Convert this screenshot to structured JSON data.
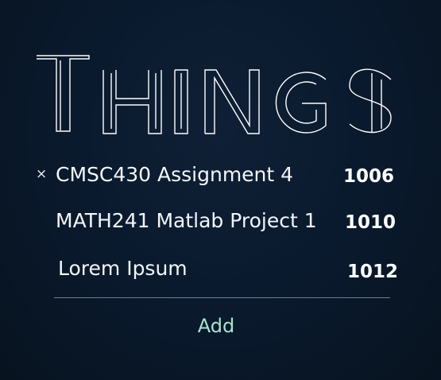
{
  "title": "THINGS",
  "items": [
    {
      "label": "CMSC430 Assignment 4",
      "number": "1006",
      "remove_symbol": "×"
    },
    {
      "label": "MATH241 Matlab Project 1",
      "number": "1010"
    },
    {
      "label": "Lorem Ipsum",
      "number": "1012"
    }
  ],
  "add_label": "Add",
  "colors": {
    "background": "#0a1a2e",
    "text": "#ffffff",
    "divider": "#8a97a6",
    "add_accent": "#a6e3cf"
  }
}
